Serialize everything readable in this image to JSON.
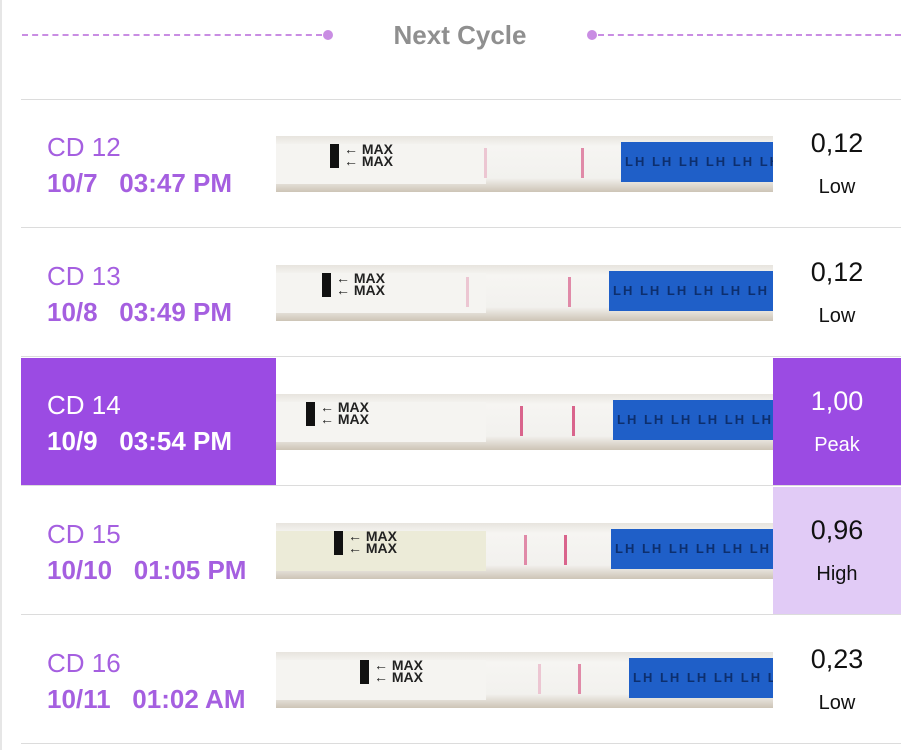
{
  "header": {
    "title": "Next Cycle"
  },
  "rows": [
    {
      "cd": "CD 12",
      "datetime": "10/7   03:47 PM",
      "value": "0,12",
      "level": "Low"
    },
    {
      "cd": "CD 13",
      "datetime": "10/8   03:49 PM",
      "value": "0,12",
      "level": "Low"
    },
    {
      "cd": "CD 14",
      "datetime": "10/9   03:54 PM",
      "value": "1,00",
      "level": "Peak"
    },
    {
      "cd": "CD 15",
      "datetime": "10/10   01:05 PM",
      "value": "0,96",
      "level": "High"
    },
    {
      "cd": "CD 16",
      "datetime": "10/11   01:02 AM",
      "value": "0,23",
      "level": "Low"
    }
  ],
  "strip": {
    "arrow_text": "← MAX\n← MAX",
    "handle_text": "LH LH LH LH LH LH"
  },
  "colors": {
    "accent": "#9b4be3",
    "text_accent": "#a55fe0",
    "high_highlight": "#e1cbf6",
    "handle_blue": "#1f5fc8",
    "test_line": "#e08aa8"
  }
}
